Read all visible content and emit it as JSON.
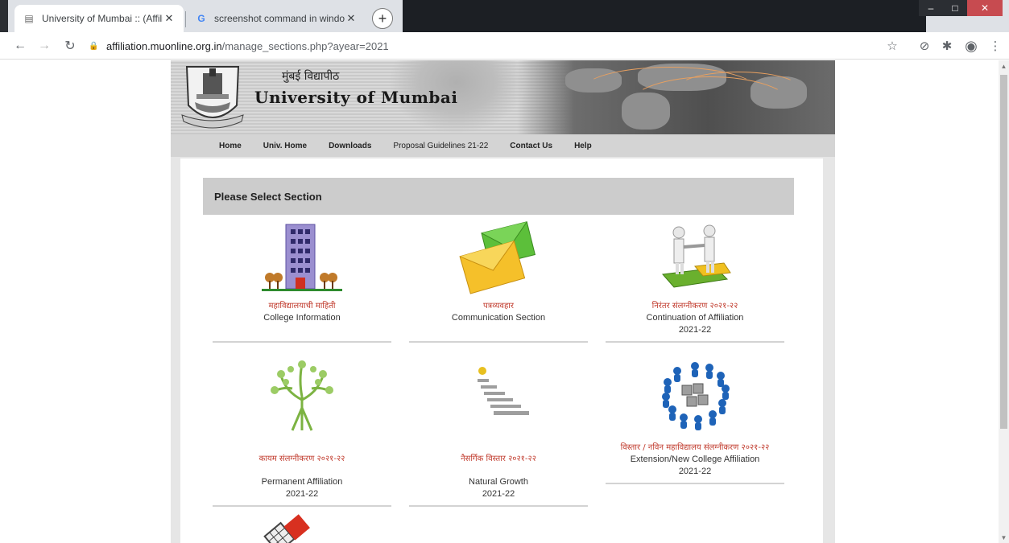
{
  "browser": {
    "tabs": [
      {
        "title": "University of Mumbai :: (Affiliatio",
        "active": true,
        "favicon": "university-favicon"
      },
      {
        "title": "screenshot command in window",
        "active": false,
        "favicon": "google-favicon"
      }
    ],
    "url_host": "affiliation.muonline.org.in",
    "url_path": "/manage_sections.php?ayear=2021"
  },
  "site": {
    "marathi_name": "मुंबई विद्यापीठ",
    "english_name": "University of Mumbai",
    "menu": [
      "Home",
      "Univ. Home",
      "Downloads",
      "Proposal Guidelines 21-22",
      "Contact Us",
      "Help"
    ]
  },
  "section_heading": "Please Select Section",
  "cards": [
    {
      "marathi": "महाविद्यालयाची माहिती",
      "english": "College Information",
      "year": "",
      "icon": "college-building-icon"
    },
    {
      "marathi": "पत्रव्यवहार",
      "english": "Communication Section",
      "year": "",
      "icon": "envelope-icon"
    },
    {
      "marathi": "निरंतर संलग्नीकरण २०२१-२२",
      "english": "Continuation of Affiliation",
      "year": "2021-22",
      "icon": "handshake-puzzle-icon"
    },
    {
      "marathi": "कायम संलग्नीकरण २०२१-२२",
      "english": "Permanent Affiliation",
      "year": "2021-22",
      "icon": "tree-figure-icon"
    },
    {
      "marathi": "नैसर्गिक विस्तार २०२१-२२",
      "english": "Natural Growth",
      "year": "2021-22",
      "icon": "staircase-icon"
    },
    {
      "marathi": "विस्तार / नविन महाविद्यालय संलग्नीकरण २०२१-२२",
      "english": "Extension/New College Affiliation",
      "year": "2021-22",
      "icon": "people-circle-icon"
    }
  ],
  "colors": {
    "marathi_label": "#c0392b",
    "section_bar": "#cccccc",
    "menu_bar": "#d4d4d4"
  }
}
